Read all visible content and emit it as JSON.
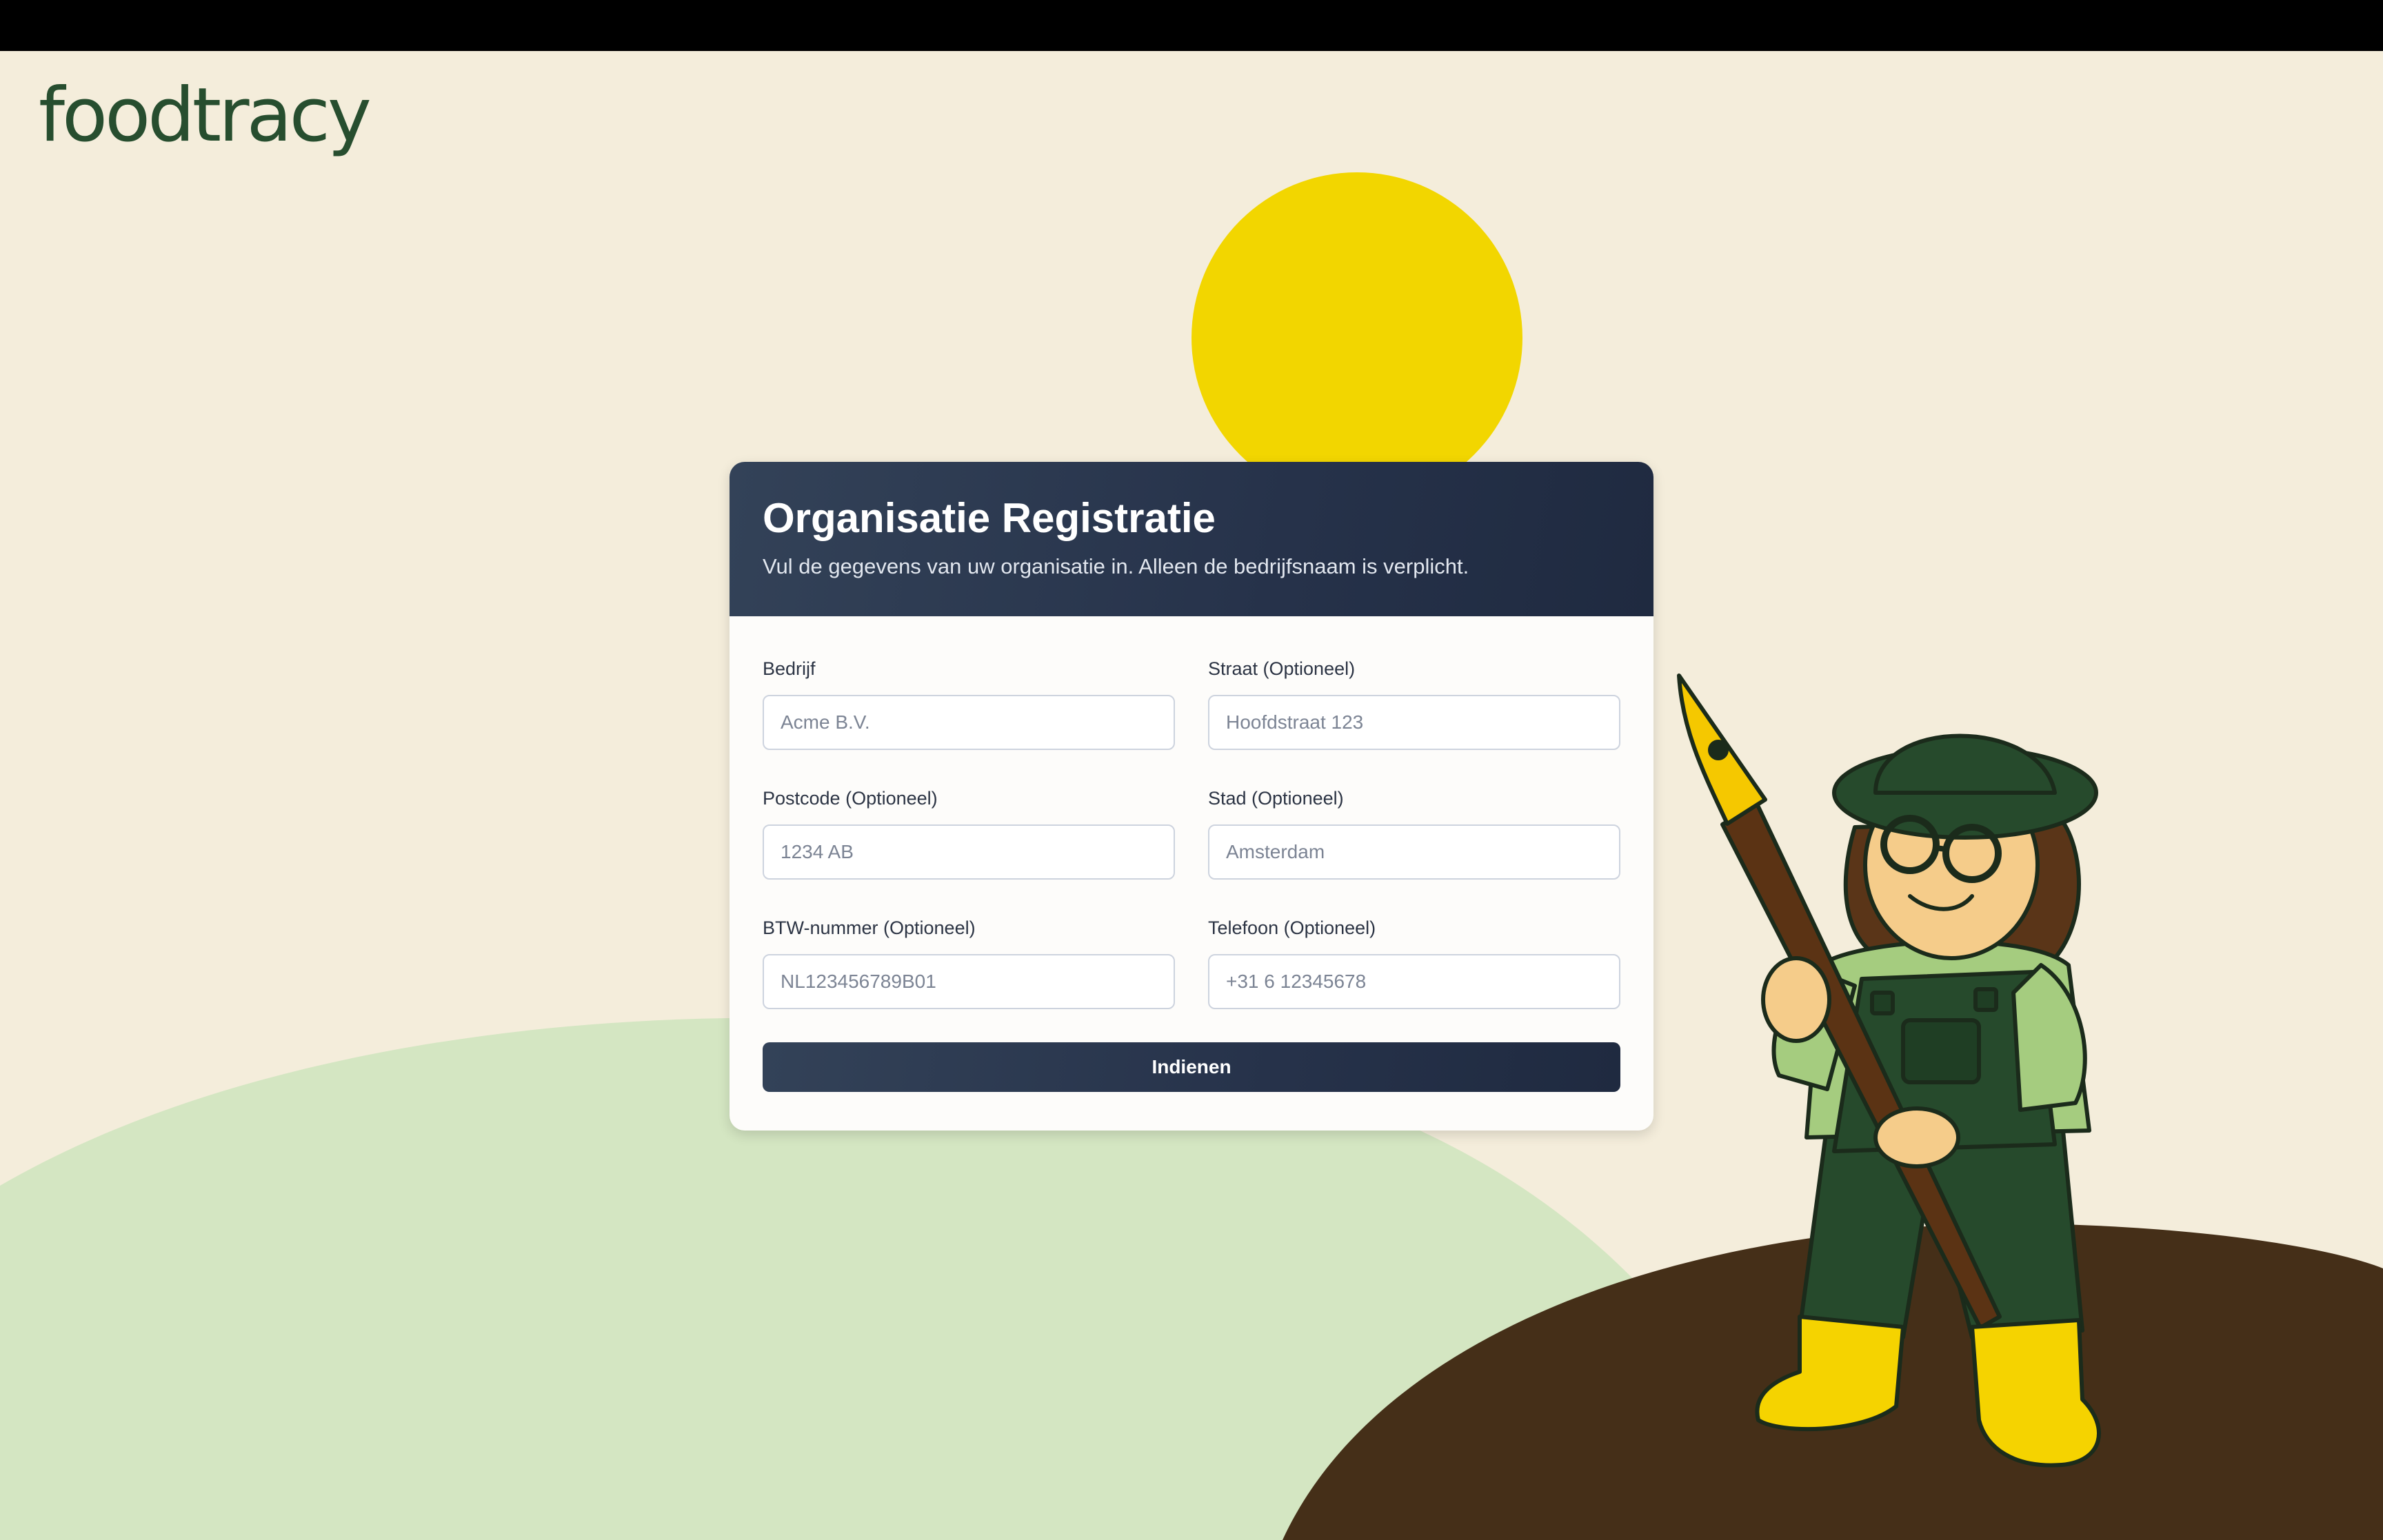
{
  "brand": {
    "name": "foodtracy",
    "color": "#274e2f"
  },
  "colors": {
    "background": "#f4eddb",
    "sun": "#f2d600",
    "hill": "#d4e6c2",
    "soil": "#452f18",
    "header": "#26324a"
  },
  "form": {
    "title": "Organisatie Registratie",
    "subtitle": "Vul de gegevens van uw organisatie in. Alleen de bedrijfsnaam is verplicht.",
    "fields": [
      {
        "label": "Bedrijf",
        "placeholder": "Acme B.V."
      },
      {
        "label": "Straat (Optioneel)",
        "placeholder": "Hoofdstraat 123"
      },
      {
        "label": "Postcode (Optioneel)",
        "placeholder": "1234 AB"
      },
      {
        "label": "Stad (Optioneel)",
        "placeholder": "Amsterdam"
      },
      {
        "label": "BTW-nummer (Optioneel)",
        "placeholder": "NL123456789B01"
      },
      {
        "label": "Telefoon (Optioneel)",
        "placeholder": "+31 6 12345678"
      }
    ],
    "submit_label": "Indienen"
  },
  "illustration": {
    "subject": "farmer-with-fountain-pen-icon"
  }
}
